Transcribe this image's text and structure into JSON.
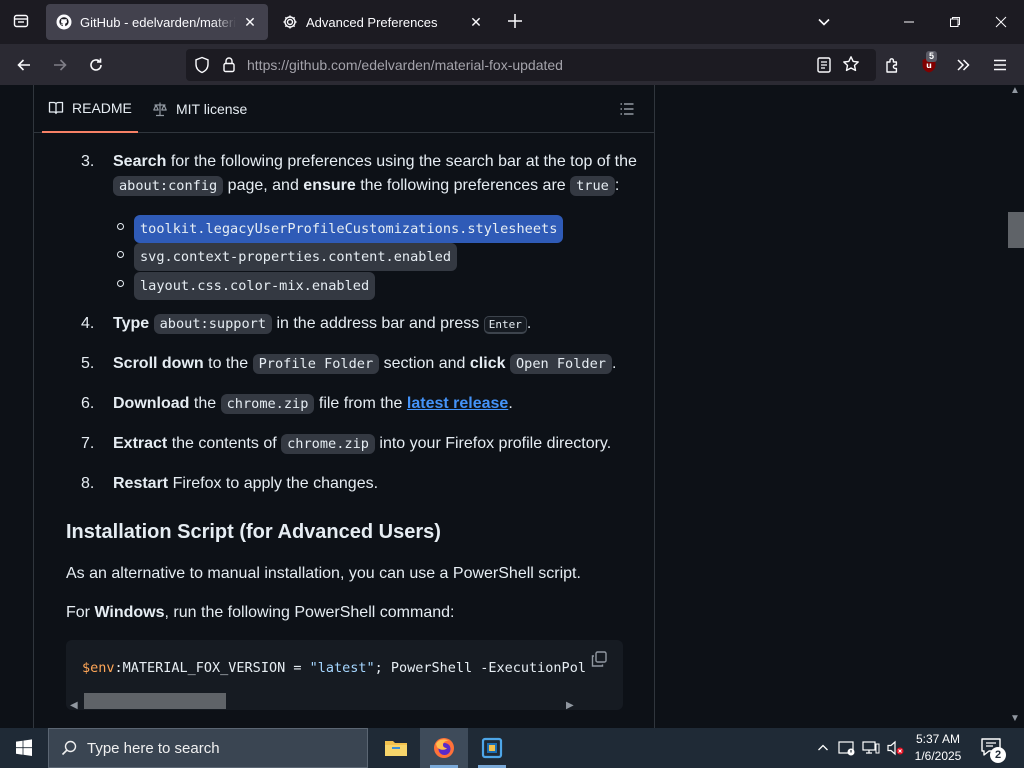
{
  "browser": {
    "tabs": [
      {
        "title": "GitHub - edelvarden/material-fox-updated",
        "active": true
      },
      {
        "title": "Advanced Preferences",
        "active": false
      }
    ],
    "url_prefix": "https://github.com",
    "url_path": "/edelvarden/material-fox-updated",
    "extension_badge": "5"
  },
  "readme": {
    "tabs": {
      "readme": "README",
      "license": "MIT license"
    },
    "steps": [
      {
        "num": "3.",
        "parts": {
          "b1": "Search",
          "t1": " for the following preferences using the search bar at the top of the ",
          "c1": "about:config",
          "t2": " page, and ",
          "b2": "ensure",
          "t3": " the following preferences are ",
          "c2": "true",
          "t4": ":"
        }
      },
      {
        "num": "4.",
        "parts": {
          "b1": "Type",
          "c1": "about:support",
          "t1": " in the address bar and press ",
          "k1": "Enter",
          "t2": "."
        }
      },
      {
        "num": "5.",
        "parts": {
          "b1": "Scroll down",
          "t1": " to the ",
          "c1": "Profile Folder",
          "t2": " section and ",
          "b2": "click",
          "c2": "Open Folder",
          "t3": "."
        }
      },
      {
        "num": "6.",
        "parts": {
          "b1": "Download",
          "t1": " the ",
          "c1": "chrome.zip",
          "t2": " file from the ",
          "l1": "latest release",
          "t3": "."
        }
      },
      {
        "num": "7.",
        "parts": {
          "b1": "Extract",
          "t1": " the contents of ",
          "c1": "chrome.zip",
          "t2": " into your Firefox profile directory."
        }
      },
      {
        "num": "8.",
        "parts": {
          "b1": "Restart",
          "t1": " Firefox to apply the changes."
        }
      }
    ],
    "prefs": [
      "toolkit.legacyUserProfileCustomizations.stylesheets",
      "svg.context-properties.content.enabled",
      "layout.css.color-mix.enabled"
    ],
    "heading": "Installation Script (for Advanced Users)",
    "para1": "As an alternative to manual installation, you can use a PowerShell script.",
    "para2": {
      "t1": "For ",
      "b1": "Windows",
      "t2": ", run the following PowerShell command:"
    },
    "code": {
      "var": "$env",
      "rest1": ":MATERIAL_FOX_VERSION = ",
      "str": "\"latest\"",
      "rest2": "; PowerShell -ExecutionPol"
    }
  },
  "taskbar": {
    "search_placeholder": "Type here to search",
    "time": "5:37 AM",
    "date": "1/6/2025",
    "notifications": "2"
  },
  "colors": {
    "accent_link": "#4493f8",
    "highlight": "#2f5bb7",
    "tab_underline": "#f78166"
  }
}
